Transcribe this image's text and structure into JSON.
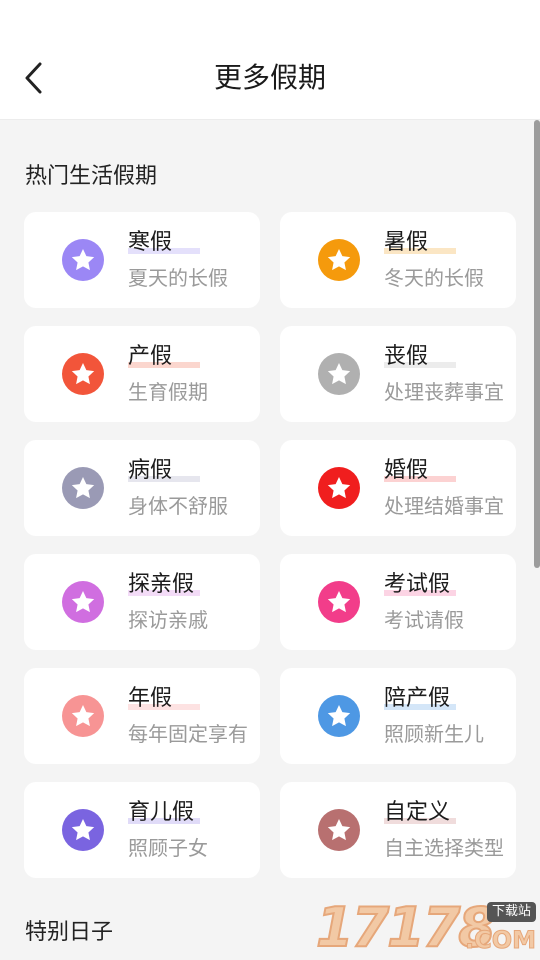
{
  "header": {
    "title": "更多假期"
  },
  "sections": [
    {
      "title": "热门生活假期"
    },
    {
      "title": "特别日子"
    }
  ],
  "cards": [
    {
      "name": "寒假",
      "desc": "夏天的长假",
      "icon": "star-icon",
      "color": "#9b87f5",
      "underline": "#e4e0fb"
    },
    {
      "name": "暑假",
      "desc": "冬天的长假",
      "icon": "star-icon",
      "color": "#f59a0c",
      "underline": "#fbe6c4"
    },
    {
      "name": "产假",
      "desc": "生育假期",
      "icon": "star-icon",
      "color": "#f2553a",
      "underline": "#fbd6ce"
    },
    {
      "name": "丧假",
      "desc": "处理丧葬事宜",
      "icon": "star-icon",
      "color": "#b0b0b0",
      "underline": "#ececec"
    },
    {
      "name": "病假",
      "desc": "身体不舒服",
      "icon": "star-icon",
      "color": "#9a9ab5",
      "underline": "#e6e6ee"
    },
    {
      "name": "婚假",
      "desc": "处理结婚事宜",
      "icon": "star-icon",
      "color": "#f01e1e",
      "underline": "#fcd2d2"
    },
    {
      "name": "探亲假",
      "desc": "探访亲戚",
      "icon": "star-icon",
      "color": "#d06ee0",
      "underline": "#f3dbf7"
    },
    {
      "name": "考试假",
      "desc": "考试请假",
      "icon": "star-icon",
      "color": "#f23d8a",
      "underline": "#fcd4e4"
    },
    {
      "name": "年假",
      "desc": "每年固定享有",
      "icon": "star-icon",
      "color": "#f79494",
      "underline": "#fde2e2"
    },
    {
      "name": "陪产假",
      "desc": "照顾新生儿",
      "icon": "star-icon",
      "color": "#4e98e4",
      "underline": "#d4e6f8"
    },
    {
      "name": "育儿假",
      "desc": "照顾子女",
      "icon": "star-icon",
      "color": "#7a64e0",
      "underline": "#e0dbf8"
    },
    {
      "name": "自定义",
      "desc": "自主选择类型",
      "icon": "star-icon",
      "color": "#b87070",
      "underline": "#f0dcdc"
    }
  ],
  "watermark": {
    "number": "17178",
    "tag": "下载站",
    "domain": ".COM"
  }
}
